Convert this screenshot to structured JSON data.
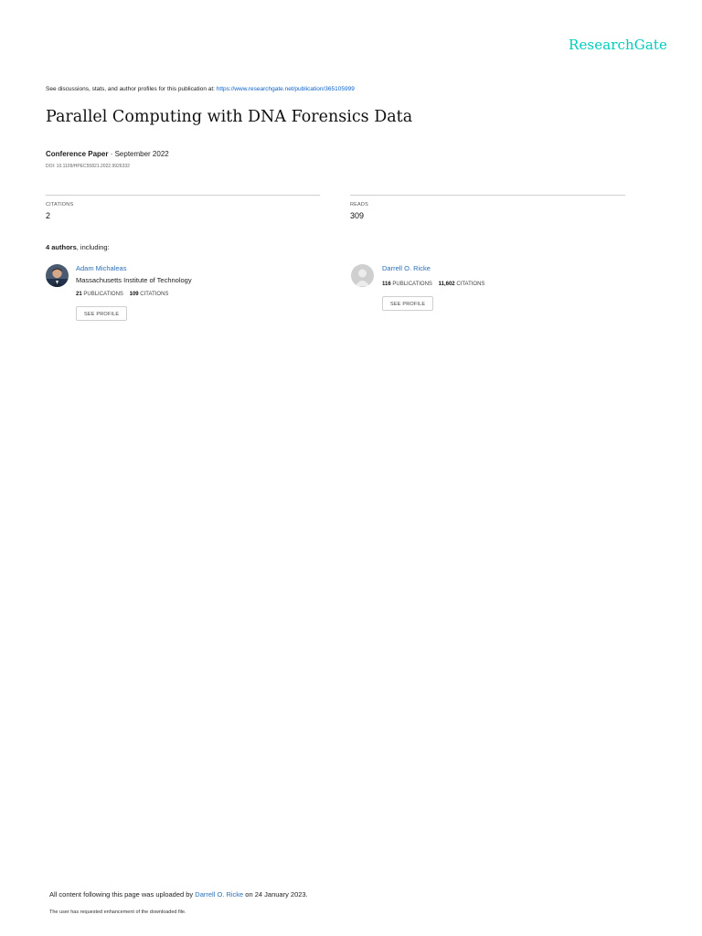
{
  "brand": {
    "logo_text": "ResearchGate",
    "accent_color": "#00ccbb",
    "link_color": "#2a6fb4"
  },
  "header": {
    "discuss_text": "See discussions, stats, and author profiles for this publication at: ",
    "publication_url": "https://www.researchgate.net/publication/365105999"
  },
  "paper": {
    "title": "Parallel Computing with DNA Forensics Data",
    "type": "Conference Paper",
    "date_text": " · September 2022",
    "doi": "DOI: 10.1109/HPEC55821.2022.9926332"
  },
  "stats": {
    "citations_label": "CITATIONS",
    "citations_value": "2",
    "reads_label": "READS",
    "reads_value": "309"
  },
  "authors_section": {
    "count_text": "4 authors",
    "suffix_text": ", including:"
  },
  "authors": [
    {
      "name": "Adam Michaleas",
      "institution": "Massachusetts Institute of Technology",
      "publications": "21",
      "publications_label": "PUBLICATIONS",
      "citations": "109",
      "citations_label": "CITATIONS",
      "button_label": "SEE PROFILE",
      "avatar_icon": "author-photo-icon"
    },
    {
      "name": "Darrell O. Ricke",
      "institution": "",
      "publications": "116",
      "publications_label": "PUBLICATIONS",
      "citations": "11,602",
      "citations_label": "CITATIONS",
      "button_label": "SEE PROFILE",
      "avatar_icon": "default-avatar-icon"
    }
  ],
  "footer": {
    "upload_prefix": "All content following this page was uploaded by ",
    "uploader": "Darrell O. Ricke",
    "upload_suffix": " on 24 January 2023.",
    "note": "The user has requested enhancement of the downloaded file."
  }
}
